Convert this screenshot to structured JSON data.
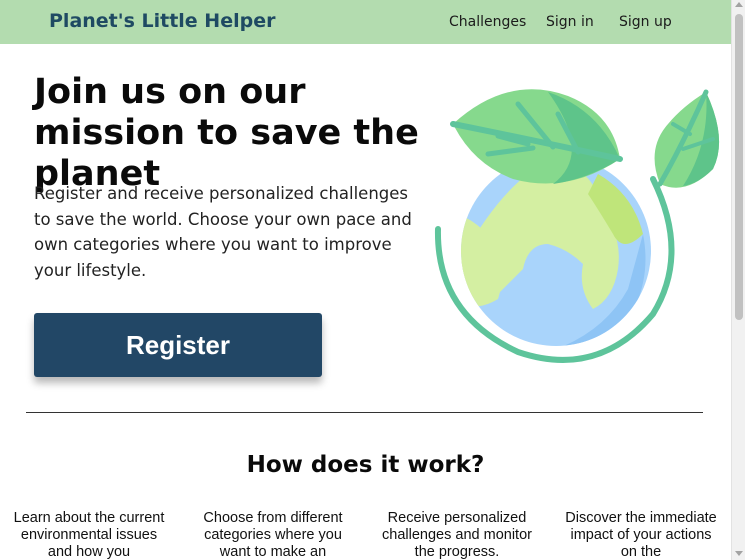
{
  "nav": {
    "brand": "Planet's Little Helper",
    "links": [
      "Challenges",
      "Sign in",
      "Sign up"
    ]
  },
  "hero": {
    "title": "Join us on our mission to save the planet",
    "description": "Register and receive personalized challenges to save the world. Choose your own pace and own categories where you want to improve your lifestyle.",
    "register_label": "Register",
    "illustration_icon": "earth-with-leaves-icon"
  },
  "how_it_works": {
    "title": "How does it work?",
    "steps": [
      "Learn about the current environmental issues and how you",
      "Choose from different categories where you want to make an",
      "Receive personalized challenges and monitor the progress.",
      "Discover the immediate impact of your actions on the"
    ]
  },
  "colors": {
    "navbar": "#b3dcaf",
    "brand": "#1f4a63",
    "button": "#224766",
    "leaf_light": "#86d98d",
    "leaf_dark": "#5ec48a",
    "ocean": "#a9d4fb",
    "land": "#d4efa2"
  }
}
